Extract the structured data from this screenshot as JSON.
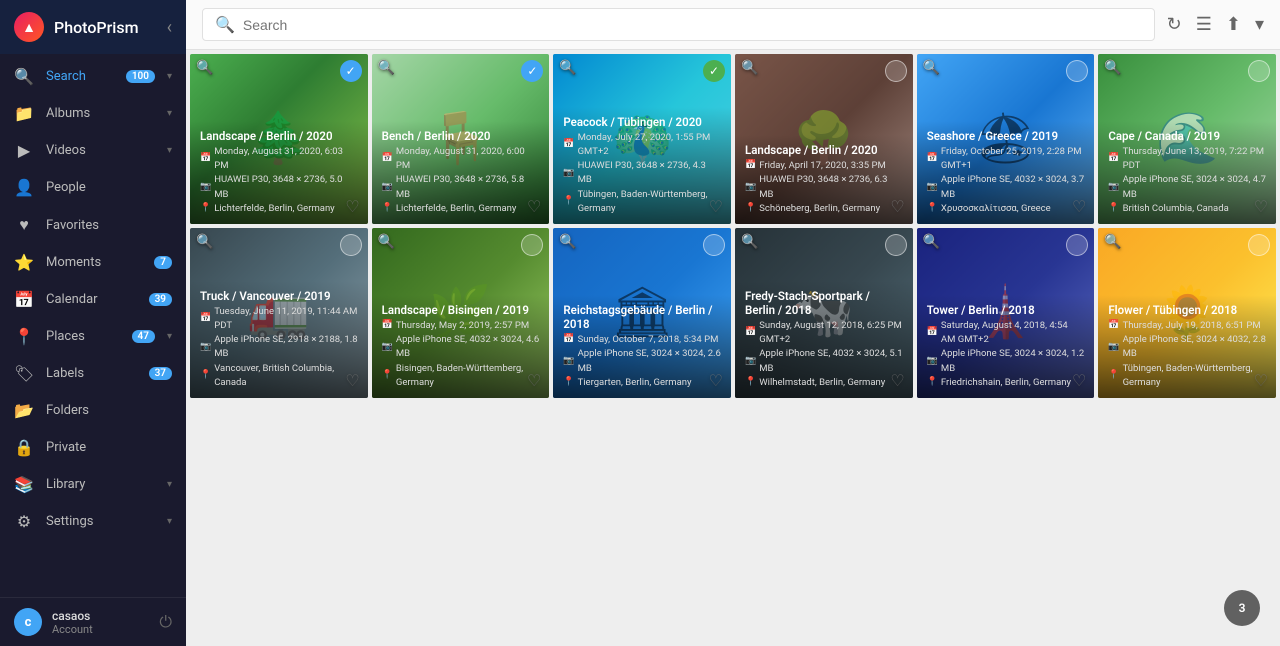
{
  "app": {
    "title": "PhotoPrism",
    "logo_letter": "▲"
  },
  "topbar": {
    "search_placeholder": "Search",
    "refresh_icon": "↻",
    "view_icon": "☰",
    "upload_icon": "⬆",
    "more_icon": "▾"
  },
  "sidebar": {
    "collapse_icon": "‹",
    "items": [
      {
        "id": "search",
        "label": "Search",
        "icon": "🔍",
        "badge": "100",
        "arrow": "▾",
        "active": true
      },
      {
        "id": "albums",
        "label": "Albums",
        "icon": "📁",
        "badge": null,
        "arrow": "▾",
        "active": false
      },
      {
        "id": "videos",
        "label": "Videos",
        "icon": "▶",
        "badge": null,
        "arrow": "▾",
        "active": false
      },
      {
        "id": "people",
        "label": "People",
        "icon": "👤",
        "badge": null,
        "arrow": null,
        "active": false
      },
      {
        "id": "favorites",
        "label": "Favorites",
        "icon": "♥",
        "badge": null,
        "arrow": null,
        "active": false
      },
      {
        "id": "moments",
        "label": "Moments",
        "icon": "⭐",
        "badge": "7",
        "arrow": null,
        "active": false
      },
      {
        "id": "calendar",
        "label": "Calendar",
        "icon": "📅",
        "badge": "39",
        "arrow": null,
        "active": false
      },
      {
        "id": "places",
        "label": "Places",
        "icon": "📍",
        "badge": "47",
        "arrow": "▾",
        "active": false
      },
      {
        "id": "labels",
        "label": "Labels",
        "icon": "🏷",
        "badge": "37",
        "arrow": null,
        "active": false
      },
      {
        "id": "folders",
        "label": "Folders",
        "icon": "📂",
        "badge": null,
        "arrow": null,
        "active": false
      },
      {
        "id": "private",
        "label": "Private",
        "icon": "🔒",
        "badge": null,
        "arrow": null,
        "active": false
      },
      {
        "id": "library",
        "label": "Library",
        "icon": "📚",
        "badge": null,
        "arrow": "▾",
        "active": false
      },
      {
        "id": "settings",
        "label": "Settings",
        "icon": "⚙",
        "badge": null,
        "arrow": "▾",
        "active": false
      }
    ],
    "footer": {
      "avatar_letter": "c",
      "username": "casaos",
      "account_label": "Account",
      "power_icon": "⏻"
    }
  },
  "photos": [
    {
      "row": 1,
      "cells": [
        {
          "id": "p1",
          "bg": "photo-bg-1",
          "title": "Landscape / Berlin / 2020",
          "date": "Monday, August 31, 2020, 6:03 PM",
          "device": "HUAWEI P30, 3648 × 2736, 5.0 MB",
          "location": "Lichterfelde, Berlin, Germany",
          "checked": "blue",
          "emoji": "🌲"
        },
        {
          "id": "p2",
          "bg": "photo-bg-2",
          "title": "Bench / Berlin / 2020",
          "date": "Monday, August 31, 2020, 6:00 PM",
          "device": "HUAWEI P30, 3648 × 2736, 5.8 MB",
          "location": "Lichterfelde, Berlin, Germany",
          "checked": "blue",
          "emoji": "🪑"
        },
        {
          "id": "p3",
          "bg": "photo-bg-3",
          "title": "Peacock / Tübingen / 2020",
          "date": "Monday, July 27, 2020, 1:55 PM GMT+2",
          "device": "HUAWEI P30, 3648 × 2736, 4.3 MB",
          "location": "Tübingen, Baden-Württemberg, Germany",
          "checked": "green",
          "emoji": "🦚"
        },
        {
          "id": "p4",
          "bg": "photo-bg-4",
          "title": "Landscape / Berlin / 2020",
          "date": "Friday, April 17, 2020, 3:35 PM",
          "device": "HUAWEI P30, 3648 × 2736, 6.3 MB",
          "location": "Schöneberg, Berlin, Germany",
          "checked": "none",
          "emoji": "🌳"
        },
        {
          "id": "p5",
          "bg": "photo-bg-5",
          "title": "Seashore / Greece / 2019",
          "date": "Friday, October 25, 2019, 2:28 PM GMT+1",
          "device": "Apple iPhone SE, 4032 × 3024, 3.7 MB",
          "location": "Χρυσοσκαλίτισσα, Greece",
          "checked": "none",
          "emoji": "🏖"
        },
        {
          "id": "p6",
          "bg": "photo-bg-6",
          "title": "Cape / Canada / 2019",
          "date": "Thursday, June 13, 2019, 7:22 PM PDT",
          "device": "Apple iPhone SE, 3024 × 3024, 4.7 MB",
          "location": "British Columbia, Canada",
          "checked": "none",
          "emoji": "🌊"
        }
      ]
    },
    {
      "row": 2,
      "cells": [
        {
          "id": "p7",
          "bg": "photo-bg-7",
          "title": "Truck / Vancouver / 2019",
          "date": "Tuesday, June 11, 2019, 11:44 AM PDT",
          "device": "Apple iPhone SE, 2918 × 2188, 1.8 MB",
          "location": "Vancouver, British Columbia, Canada",
          "checked": "none",
          "emoji": "🚛"
        },
        {
          "id": "p8",
          "bg": "photo-bg-8",
          "title": "Landscape / Bisingen / 2019",
          "date": "Thursday, May 2, 2019, 2:57 PM",
          "device": "Apple iPhone SE, 4032 × 3024, 4.6 MB",
          "location": "Bisingen, Baden-Württemberg, Germany",
          "checked": "none",
          "emoji": "🌿"
        },
        {
          "id": "p9",
          "bg": "photo-bg-9",
          "title": "Reichstagsgebäude / Berlin / 2018",
          "date": "Sunday, October 7, 2018, 5:34 PM",
          "device": "Apple iPhone SE, 3024 × 3024, 2.6 MB",
          "location": "Tiergarten, Berlin, Germany",
          "checked": "none",
          "emoji": "🏛"
        },
        {
          "id": "p10",
          "bg": "photo-bg-10",
          "title": "Fredy-Stach-Sportpark / Berlin / 2018",
          "date": "Sunday, August 12, 2018, 6:25 PM GMT+2",
          "device": "Apple iPhone SE, 4032 × 3024, 5.1 MB",
          "location": "Wilhelmstadt, Berlin, Germany",
          "checked": "none",
          "emoji": "🐄"
        },
        {
          "id": "p11",
          "bg": "photo-bg-11",
          "title": "Tower / Berlin / 2018",
          "date": "Saturday, August 4, 2018, 4:54 AM GMT+2",
          "device": "Apple iPhone SE, 3024 × 3024, 1.2 MB",
          "location": "Friedrichshain, Berlin, Germany",
          "checked": "none",
          "emoji": "🗼"
        },
        {
          "id": "p12",
          "bg": "photo-bg-12",
          "title": "Flower / Tübingen / 2018",
          "date": "Thursday, July 19, 2018, 6:51 PM",
          "device": "Apple iPhone SE, 3024 × 4032, 2.8 MB",
          "location": "Tübingen, Baden-Württemberg, Germany",
          "checked": "none",
          "emoji": "🌻"
        }
      ]
    }
  ],
  "scroll_badge": "3"
}
